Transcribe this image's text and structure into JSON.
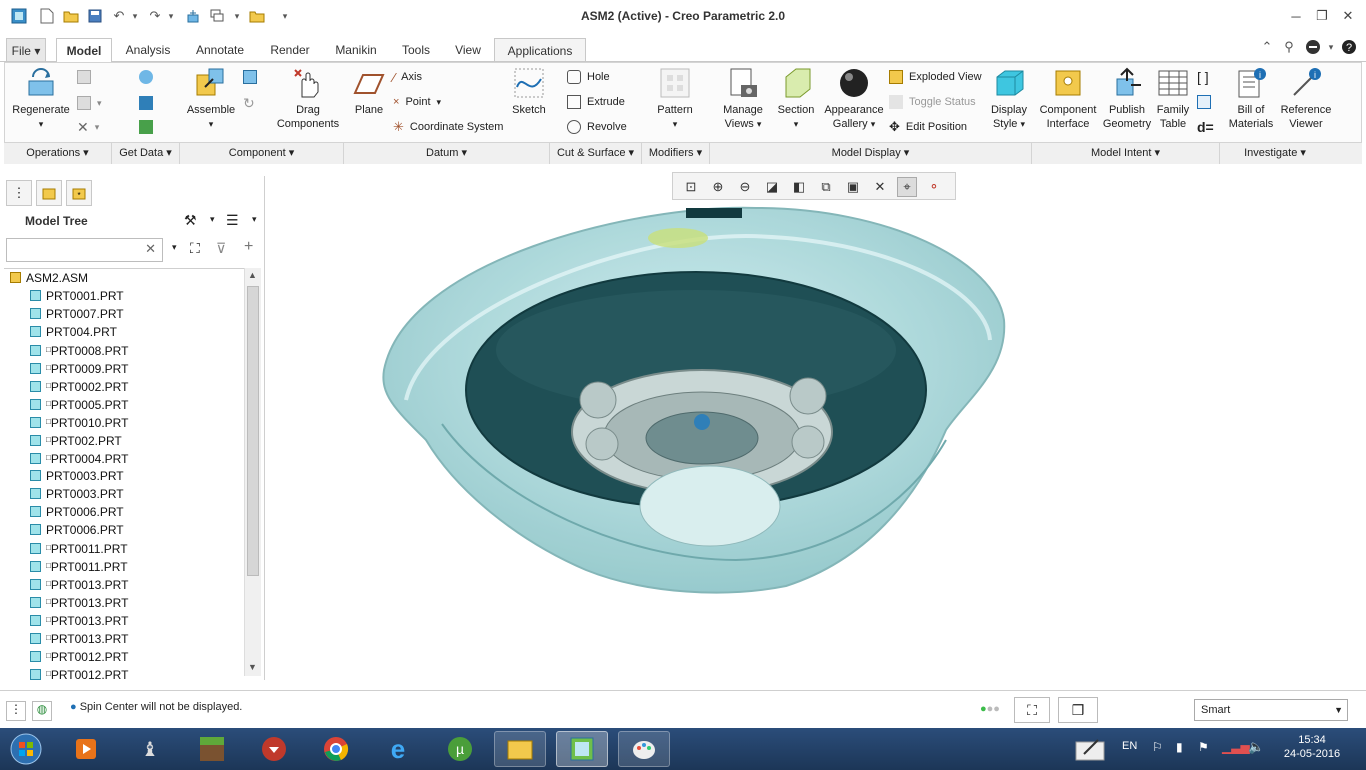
{
  "window": {
    "title": "ASM2 (Active) - Creo Parametric 2.0"
  },
  "tabs": [
    {
      "label": "File"
    },
    {
      "label": "Model"
    },
    {
      "label": "Analysis"
    },
    {
      "label": "Annotate"
    },
    {
      "label": "Render"
    },
    {
      "label": "Manikin"
    },
    {
      "label": "Tools"
    },
    {
      "label": "View"
    },
    {
      "label": "Applications"
    }
  ],
  "ribbon": {
    "regenerate": "Regenerate",
    "assemble": "Assemble",
    "drag_components": [
      "Drag",
      "Components"
    ],
    "plane": "Plane",
    "axis": "Axis",
    "point": "Point",
    "coordinate_system": "Coordinate System",
    "sketch": "Sketch",
    "hole": "Hole",
    "extrude": "Extrude",
    "revolve": "Revolve",
    "pattern": "Pattern",
    "manage_views": [
      "Manage",
      "Views"
    ],
    "section": "Section",
    "appearance_gallery": [
      "Appearance",
      "Gallery"
    ],
    "exploded_view": "Exploded View",
    "toggle_status": "Toggle Status",
    "edit_position": "Edit Position",
    "display_style": [
      "Display",
      "Style"
    ],
    "component_interface": [
      "Component",
      "Interface"
    ],
    "publish_geometry": [
      "Publish",
      "Geometry"
    ],
    "family_table": [
      "Family",
      "Table"
    ],
    "bill_of_materials": [
      "Bill of",
      "Materials"
    ],
    "reference_viewer": [
      "Reference",
      "Viewer"
    ],
    "d_equals": "d="
  },
  "groups": [
    {
      "label": "Operations"
    },
    {
      "label": "Get Data"
    },
    {
      "label": "Component"
    },
    {
      "label": "Datum"
    },
    {
      "label": "Cut & Surface"
    },
    {
      "label": "Modifiers"
    },
    {
      "label": "Model Display"
    },
    {
      "label": "Model Intent"
    },
    {
      "label": "Investigate"
    }
  ],
  "model_tree": {
    "title": "Model Tree",
    "root": "ASM2.ASM",
    "items": [
      {
        "name": "PRT0001.PRT",
        "marker": ""
      },
      {
        "name": "PRT0007.PRT",
        "marker": ""
      },
      {
        "name": "PRT004.PRT",
        "marker": ""
      },
      {
        "name": "PRT0008.PRT",
        "marker": "□"
      },
      {
        "name": "PRT0009.PRT",
        "marker": "□"
      },
      {
        "name": "PRT0002.PRT",
        "marker": "□"
      },
      {
        "name": "PRT0005.PRT",
        "marker": "□"
      },
      {
        "name": "PRT0010.PRT",
        "marker": "□"
      },
      {
        "name": "PRT002.PRT",
        "marker": "□"
      },
      {
        "name": "PRT0004.PRT",
        "marker": "□"
      },
      {
        "name": "PRT0003.PRT",
        "marker": ""
      },
      {
        "name": "PRT0003.PRT",
        "marker": ""
      },
      {
        "name": "PRT0006.PRT",
        "marker": ""
      },
      {
        "name": "PRT0006.PRT",
        "marker": ""
      },
      {
        "name": "PRT0011.PRT",
        "marker": "□"
      },
      {
        "name": "PRT0011.PRT",
        "marker": "□"
      },
      {
        "name": "PRT0013.PRT",
        "marker": "□"
      },
      {
        "name": "PRT0013.PRT",
        "marker": "□"
      },
      {
        "name": "PRT0013.PRT",
        "marker": "□"
      },
      {
        "name": "PRT0013.PRT",
        "marker": "□"
      },
      {
        "name": "PRT0012.PRT",
        "marker": "□"
      },
      {
        "name": "PRT0012.PRT",
        "marker": "□"
      }
    ]
  },
  "status": {
    "message": "Spin Center will not be displayed.",
    "filter_value": "Smart"
  },
  "taskbar": {
    "language": "EN",
    "time": "15:34",
    "date": "24-05-2016"
  },
  "colors": {
    "accent": "#1e6fb4",
    "model_outer": "#a9d6d8",
    "model_inner": "#1f4f55"
  }
}
